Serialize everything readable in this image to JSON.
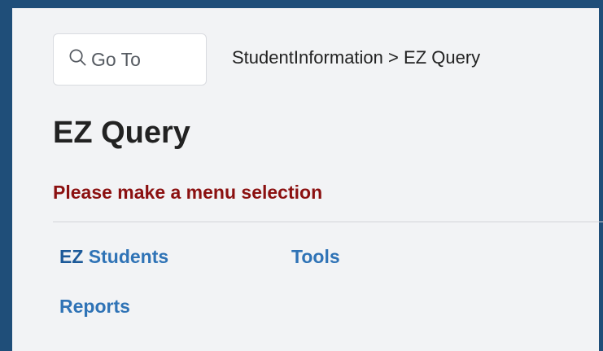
{
  "goto": {
    "label": "Go To",
    "icon": "search-icon"
  },
  "breadcrumb": {
    "items": [
      "StudentInformation",
      "EZ Query"
    ],
    "separator": ">"
  },
  "page": {
    "title": "EZ Query",
    "message": "Please make a menu selection"
  },
  "menu": {
    "items": [
      {
        "prefix": "EZ",
        "label": "Students"
      },
      {
        "label": "Tools"
      },
      {
        "label": "Reports"
      }
    ]
  },
  "colors": {
    "frame": "#1f4e79",
    "background": "#f2f3f5",
    "message": "#8b1010",
    "link": "#2f73b6"
  }
}
